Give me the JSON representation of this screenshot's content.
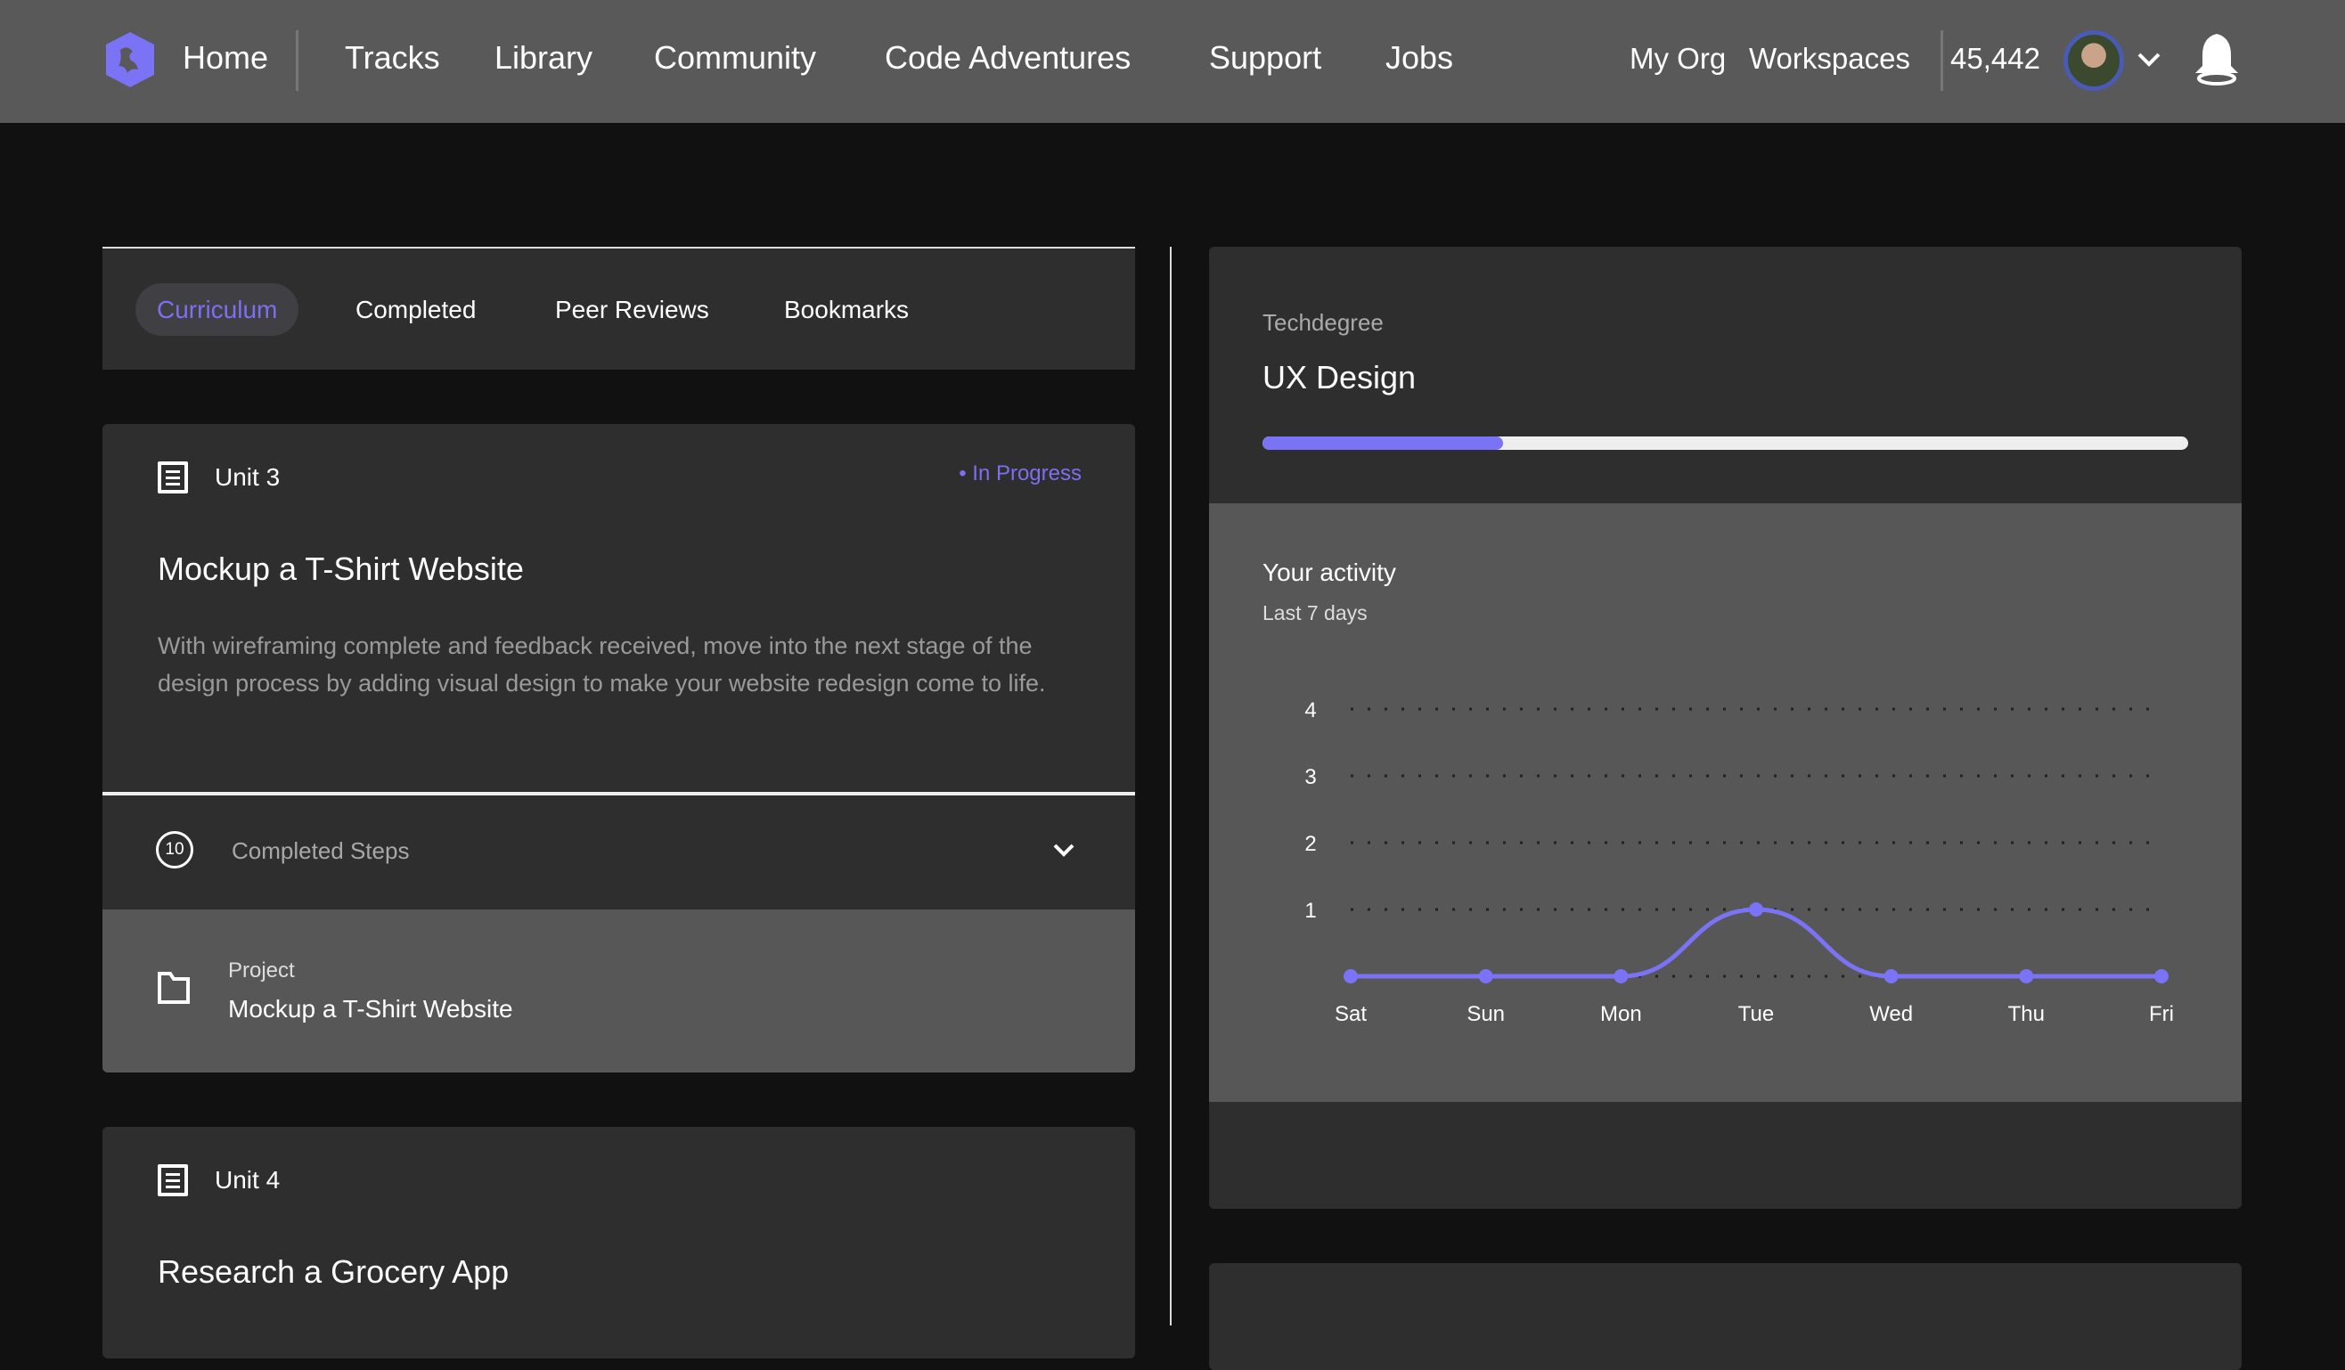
{
  "nav": {
    "home": "Home",
    "links": [
      "Tracks",
      "Library",
      "Community",
      "Code Adventures",
      "Support",
      "Jobs"
    ],
    "my_org": "My Org",
    "workspaces": "Workspaces",
    "points": "45,442",
    "logo_color": "#7b73f5"
  },
  "tabs": [
    "Curriculum",
    "Completed",
    "Peer Reviews",
    "Bookmarks"
  ],
  "unit3": {
    "label": "Unit 3",
    "status": "• In Progress",
    "title": "Mockup a T-Shirt Website",
    "description": "With wireframing complete and feedback received, move into the next stage of the design process by adding visual design to make your website redesign come to life.",
    "steps_count": "10",
    "steps_label": "Completed Steps",
    "project_type": "Project",
    "project_title": "Mockup a T-Shirt Website"
  },
  "unit4": {
    "label": "Unit 4",
    "title": "Research a Grocery App"
  },
  "techdegree": {
    "label": "Techdegree",
    "title": "UX Design",
    "progress": 0.26
  },
  "activity": {
    "title": "Your activity",
    "subtitle": "Last 7 days"
  },
  "chart_data": {
    "type": "line",
    "categories": [
      "Sat",
      "Sun",
      "Mon",
      "Tue",
      "Wed",
      "Thu",
      "Fri"
    ],
    "values": [
      0,
      0,
      0,
      1,
      0,
      0,
      0
    ],
    "y_ticks": [
      "1",
      "2",
      "3",
      "4"
    ],
    "ylim": [
      0,
      4
    ],
    "grid": "dotted horizontal",
    "color": "#7b73f5"
  },
  "accent": "#7b73f5"
}
